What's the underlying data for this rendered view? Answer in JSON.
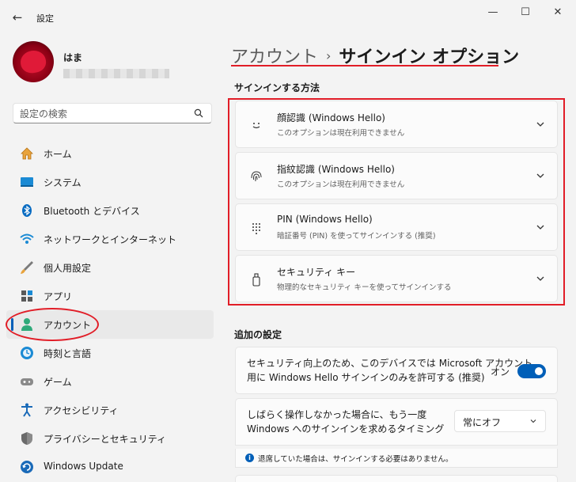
{
  "window": {
    "title": "設定",
    "back_icon": "←",
    "minimize_icon": "—",
    "maximize_icon": "☐",
    "close_icon": "✕"
  },
  "user": {
    "name": "はま"
  },
  "search": {
    "placeholder": "設定の検索"
  },
  "sidebar": {
    "items": [
      {
        "label": "ホーム",
        "icon": "home-icon"
      },
      {
        "label": "システム",
        "icon": "system-icon"
      },
      {
        "label": "Bluetooth とデバイス",
        "icon": "bluetooth-icon"
      },
      {
        "label": "ネットワークとインターネット",
        "icon": "network-icon"
      },
      {
        "label": "個人用設定",
        "icon": "personalization-icon"
      },
      {
        "label": "アプリ",
        "icon": "apps-icon"
      },
      {
        "label": "アカウント",
        "icon": "accounts-icon",
        "active": true
      },
      {
        "label": "時刻と言語",
        "icon": "time-language-icon"
      },
      {
        "label": "ゲーム",
        "icon": "gaming-icon"
      },
      {
        "label": "アクセシビリティ",
        "icon": "accessibility-icon"
      },
      {
        "label": "プライバシーとセキュリティ",
        "icon": "privacy-icon"
      },
      {
        "label": "Windows Update",
        "icon": "windows-update-icon"
      }
    ]
  },
  "breadcrumb": {
    "parent": "アカウント",
    "separator": "›",
    "current": "サインイン オプション"
  },
  "signin_section": {
    "title": "サインインする方法",
    "options": [
      {
        "title": "顔認識 (Windows Hello)",
        "subtitle": "このオプションは現在利用できません",
        "icon": "face-icon"
      },
      {
        "title": "指紋認識 (Windows Hello)",
        "subtitle": "このオプションは現在利用できません",
        "icon": "fingerprint-icon"
      },
      {
        "title": "PIN (Windows Hello)",
        "subtitle": "暗証番号 (PIN) を使ってサインインする (推奨)",
        "icon": "pin-keypad-icon"
      },
      {
        "title": "セキュリティ キー",
        "subtitle": "物理的なセキュリティ キーを使ってサインインする",
        "icon": "security-key-icon"
      }
    ]
  },
  "additional_section": {
    "title": "追加の設定",
    "hello_only": {
      "line1": "セキュリティ向上のため、このデバイスでは Microsoft アカウント",
      "line2": "用に Windows Hello サインインのみを許可する (推奨)",
      "toggle_label": "オン",
      "toggle_state": "on"
    },
    "require_signin": {
      "line1": "しばらく操作しなかった場合に、もう一度",
      "line2": "Windows へのサインインを求めるタイミング",
      "dropdown_value": "常にオフ"
    },
    "info": {
      "text": "退席していた場合は、サインインする必要はありません。",
      "icon_glyph": "i"
    }
  },
  "colors": {
    "accent": "#005fb8",
    "annotation_red": "#e11d27",
    "background": "#f3f3f3"
  }
}
